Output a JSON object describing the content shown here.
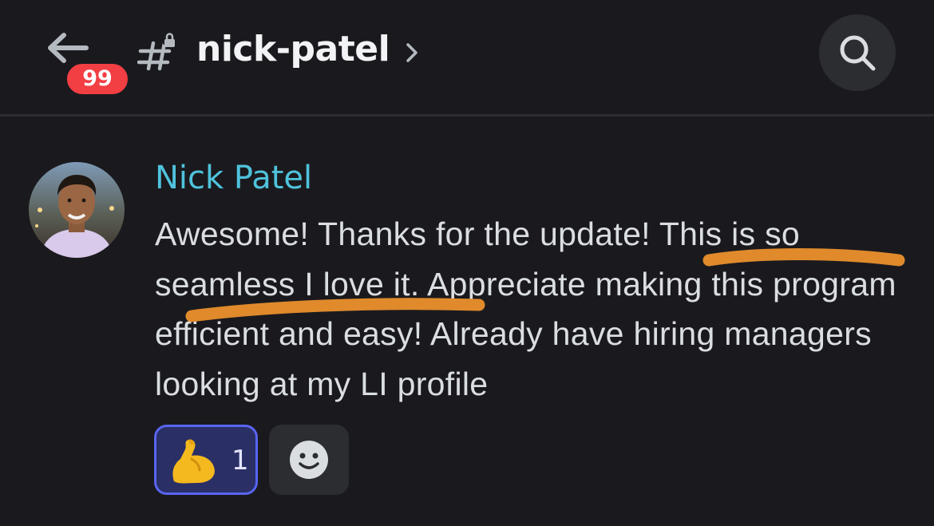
{
  "header": {
    "badge_count": "99",
    "channel_name": "nick-patel"
  },
  "message": {
    "author": "Nick Patel",
    "text": "Awesome! Thanks for the update! This is so seamless I love it. Appreciate making this program efficient and easy! Already have hiring managers looking at my LI profile"
  },
  "reactions": [
    {
      "emoji": "flexed-biceps-icon",
      "count": "1"
    }
  ],
  "icons": {
    "back": "arrow-left-icon",
    "channel": "hash-lock-icon",
    "chevron": "chevron-right-icon",
    "search": "search-icon",
    "add_reaction": "smiley-icon"
  },
  "colors": {
    "background": "#1a1a1e",
    "author": "#4fc3dc",
    "badge": "#f23f43",
    "reaction_border": "#5865f2",
    "highlight_scribble": "#e08a2c"
  }
}
